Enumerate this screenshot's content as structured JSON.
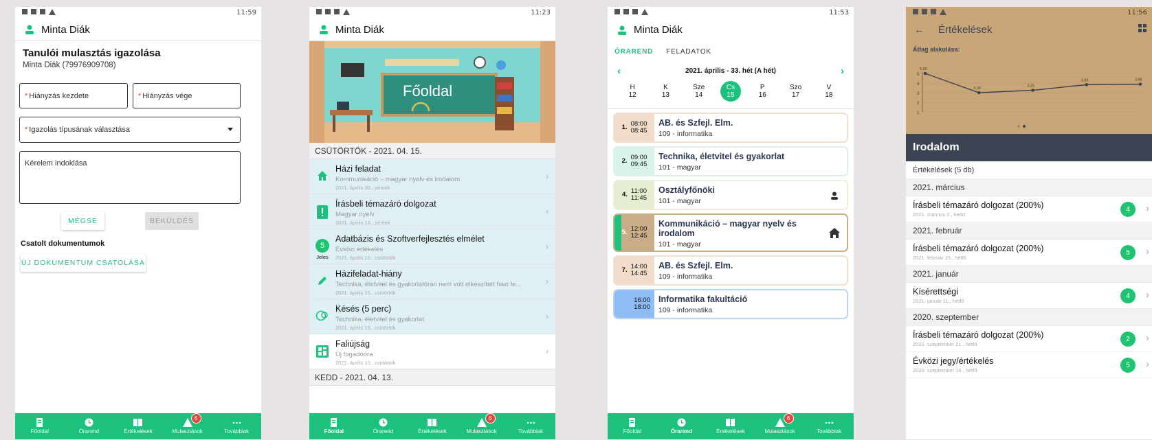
{
  "status": {
    "p1_time": "11:59",
    "p2_time": "11:23",
    "p3_time": "11:53",
    "p4_time": "11:56"
  },
  "user_name": "Minta Diák",
  "nav": [
    {
      "label": "Főoldal",
      "icon": "home-icon"
    },
    {
      "label": "Órarend",
      "icon": "clock-icon"
    },
    {
      "label": "Értékelések",
      "icon": "book-icon"
    },
    {
      "label": "Mulasztások",
      "icon": "warning-icon",
      "badge": "6"
    },
    {
      "label": "Továbbiak",
      "icon": "more-icon"
    }
  ],
  "absence": {
    "title": "Tanulói mulasztás igazolása",
    "student": "Minta Diák (79976909708)",
    "start_label": "Hiányzás kezdete",
    "end_label": "Hiányzás vége",
    "type_label": "Igazolás típusának választása",
    "reason_label": "Kérelem indoklása",
    "cancel": "MÉGSE",
    "send": "BEKÜLDÉS",
    "attach_title": "Csatolt dokumentumok",
    "attach_btn": "ÚJ DOKUMENTUM CSATOLÁSA"
  },
  "home": {
    "banner": "Főoldal",
    "day1": "CSÜTÖRTÖK - 2021. 04. 15.",
    "items": [
      {
        "title": "Házi feladat",
        "sub": "Kommunikáció – magyar nyelv és irodalom",
        "date": "2021. április 30., péntek",
        "icon": "house-icon"
      },
      {
        "title": "Írásbeli témazáró dolgozat",
        "sub": "Magyar nyelv",
        "date": "2021. április 16., péntek",
        "icon": "exclamation-icon"
      },
      {
        "title": "Adatbázis és Szoftverfejlesztés elmélet",
        "sub": "Évközi értékelés",
        "date": "2021. április 15., csütörtök",
        "grade": "5",
        "grade_label": "Jeles"
      },
      {
        "title": "Házifeladat-hiány",
        "sub": "Technika, életvitel és gyakorlatórán nem volt elkészített házi fe...",
        "date": "2021. április 15., csütörtök",
        "icon": "pencil-icon"
      },
      {
        "title": "Késés (5 perc)",
        "sub": "Technika, életvitel és gyakorlat",
        "date": "2021. április 15., csütörtök",
        "icon": "late-icon"
      },
      {
        "title": "Faliújság",
        "sub": "Új fogadóóra",
        "date": "2021. április 15., csütörtök",
        "icon": "board-icon"
      }
    ],
    "day2": "KEDD - 2021. 04. 13."
  },
  "timetable": {
    "tab1": "ÓRAREND",
    "tab2": "FELADATOK",
    "week": "2021. április - 33. hét (A hét)",
    "days": [
      {
        "d": "H",
        "n": "12"
      },
      {
        "d": "K",
        "n": "13"
      },
      {
        "d": "Sze",
        "n": "14"
      },
      {
        "d": "Cs",
        "n": "15"
      },
      {
        "d": "P",
        "n": "16"
      },
      {
        "d": "Szo",
        "n": "17"
      },
      {
        "d": "V",
        "n": "18"
      }
    ],
    "lessons": [
      {
        "num": "1.",
        "from": "08:00",
        "to": "08:45",
        "name": "AB. és Szfejl. Elm.",
        "room": "109 - informatika"
      },
      {
        "num": "2.",
        "from": "09:00",
        "to": "09:45",
        "name": "Technika, életvitel és gyakorlat",
        "room": "101 - magyar"
      },
      {
        "num": "4.",
        "from": "11:00",
        "to": "11:45",
        "name": "Osztályfőnöki",
        "room": "101 - magyar"
      },
      {
        "num": "5.",
        "from": "12:00",
        "to": "12:45",
        "name": "Kommunikáció – magyar nyelv és irodalom",
        "room": "101 - magyar"
      },
      {
        "num": "7.",
        "from": "14:00",
        "to": "14:45",
        "name": "AB. és Szfejl. Elm.",
        "room": "109 - informatika"
      },
      {
        "num": "",
        "from": "16:00",
        "to": "18:00",
        "name": "Informatika fakultáció",
        "room": "109 - informatika"
      }
    ]
  },
  "grades": {
    "title": "Értékelések",
    "avg_label": "Átlag alakulása:",
    "subject": "Irodalom",
    "count": "Értékelések (5 db)",
    "chart_data": {
      "type": "line",
      "values": [
        5.0,
        3.0,
        3.25,
        3.83,
        3.88
      ],
      "value_labels": [
        "5,00",
        "3,00",
        "3,25",
        "3,83",
        "3,88"
      ],
      "y_ticks": [
        "5",
        "4",
        "3",
        "2",
        "1"
      ],
      "ylim": [
        1,
        5
      ]
    },
    "months": [
      {
        "m": "2021. március",
        "rows": [
          {
            "t": "Írásbeli témazáró dolgozat (200%)",
            "d": "2021. március 2., kedd",
            "g": "4"
          }
        ]
      },
      {
        "m": "2021. február",
        "rows": [
          {
            "t": "Írásbeli témazáró dolgozat (200%)",
            "d": "2021. február 15., hétfő",
            "g": "5"
          }
        ]
      },
      {
        "m": "2021. január",
        "rows": [
          {
            "t": "Kísérettségi",
            "d": "2021. január 11., hétfő",
            "g": "4"
          }
        ]
      },
      {
        "m": "2020. szeptember",
        "rows": [
          {
            "t": "Írásbeli témazáró dolgozat (200%)",
            "d": "2020. szeptember 21., hétfő",
            "g": "2"
          },
          {
            "t": "Évközi jegy/értékelés",
            "d": "2020. szeptember 14., hétfő",
            "g": "5"
          }
        ]
      }
    ]
  },
  "colors": {
    "accent": "#1cc17e",
    "dark": "#3c4453",
    "header_tan": "#c9a678"
  }
}
